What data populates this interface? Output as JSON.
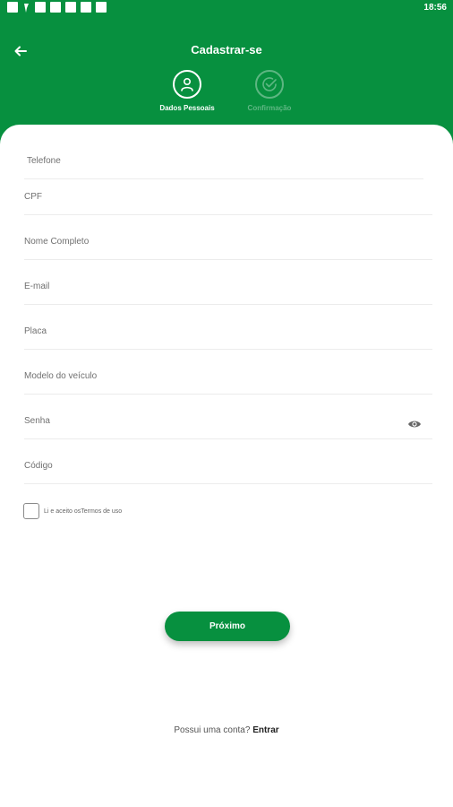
{
  "status_bar": {
    "time": "18:56",
    "icons": [
      "notification-icon",
      "location-icon",
      "notification-icon",
      "media-icon",
      "notification-icon",
      "notification-icon",
      "notification-icon"
    ]
  },
  "header": {
    "title": "Cadastrar-se",
    "background_color": "#07903F",
    "steps": [
      {
        "label": "Dados Pessoais",
        "icon": "person-icon",
        "active": true
      },
      {
        "label": "Confirmação",
        "icon": "check-circle-icon",
        "active": false
      }
    ]
  },
  "form": {
    "fields": [
      {
        "name": "telefone",
        "placeholder": "Telefone",
        "value": ""
      },
      {
        "name": "cpf",
        "placeholder": "CPF",
        "value": ""
      },
      {
        "name": "nome",
        "placeholder": "Nome Completo",
        "value": ""
      },
      {
        "name": "email",
        "placeholder": "E-mail",
        "value": ""
      },
      {
        "name": "placa",
        "placeholder": "Placa",
        "value": ""
      },
      {
        "name": "modelo",
        "placeholder": "Modelo do veículo",
        "value": ""
      },
      {
        "name": "senha",
        "placeholder": "Senha",
        "value": ""
      },
      {
        "name": "codigo",
        "placeholder": "Código",
        "value": ""
      }
    ],
    "terms": {
      "prefix": "Li e aceito os",
      "link": "Termos de uso",
      "checked": false
    },
    "next_button": "Próximo"
  },
  "footer": {
    "question": "Possui uma conta? ",
    "link": "Entrar"
  },
  "colors": {
    "primary": "#07903F",
    "text_muted": "#707070"
  }
}
